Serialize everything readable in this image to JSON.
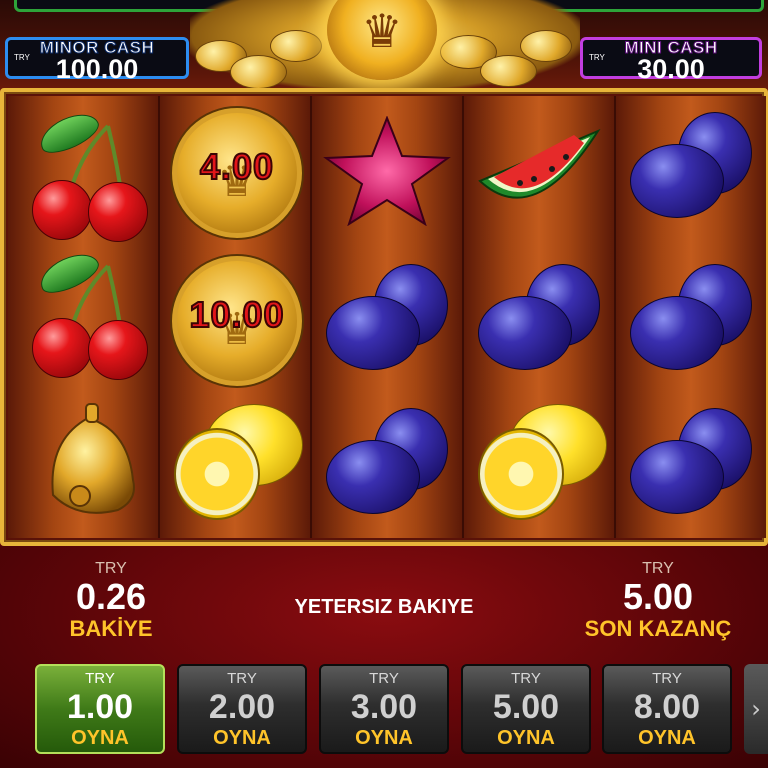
{
  "jackpots": {
    "minor": {
      "label": "MINOR CASH",
      "currency": "TRY",
      "value": "100.00"
    },
    "mini": {
      "label": "MINI CASH",
      "currency": "TRY",
      "value": "30.00"
    }
  },
  "reels": [
    [
      "cherry",
      "cherry",
      "bell"
    ],
    [
      "coin",
      "coin",
      "lemon"
    ],
    [
      "star",
      "plum",
      "plum"
    ],
    [
      "watermelon",
      "plum",
      "lemon"
    ],
    [
      "plum",
      "plum",
      "plum"
    ]
  ],
  "coin_values": {
    "reel2_row1": "4.00",
    "reel2_row2": "10.00"
  },
  "status": {
    "balance": {
      "currency": "TRY",
      "value": "0.26",
      "label": "BAKİYE"
    },
    "message": "YETERSIZ BAKIYE",
    "last_win": {
      "currency": "TRY",
      "value": "5.00",
      "label": "SON KAZANÇ"
    }
  },
  "bets": [
    {
      "currency": "TRY",
      "value": "1.00",
      "label": "OYNA",
      "selected": true
    },
    {
      "currency": "TRY",
      "value": "2.00",
      "label": "OYNA",
      "selected": false
    },
    {
      "currency": "TRY",
      "value": "3.00",
      "label": "OYNA",
      "selected": false
    },
    {
      "currency": "TRY",
      "value": "5.00",
      "label": "OYNA",
      "selected": false
    },
    {
      "currency": "TRY",
      "value": "8.00",
      "label": "OYNA",
      "selected": false
    }
  ],
  "next_icon": "chevron-right-icon",
  "colors": {
    "frame": "#e8b53a",
    "selected_bet": "#3f7a18",
    "label_gold": "#ffc42a"
  }
}
